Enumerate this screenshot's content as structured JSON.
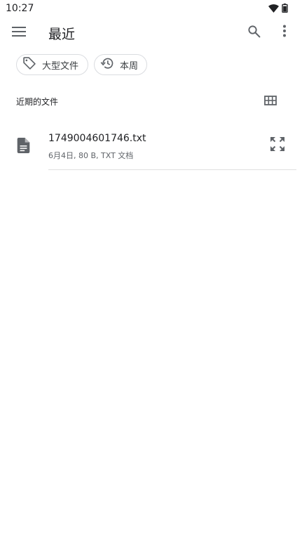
{
  "status_bar": {
    "time": "10:27",
    "icons": [
      "wifi-icon",
      "battery-icon"
    ]
  },
  "app_bar": {
    "title": "最近",
    "icons": [
      "menu-icon",
      "search-icon",
      "more-vert-icon"
    ]
  },
  "chips": [
    {
      "label": "大型文件",
      "icon": "label-tag-icon"
    },
    {
      "label": "本周",
      "icon": "history-icon"
    }
  ],
  "section": {
    "title": "近期的文件",
    "view_toggle_icon": "grid-view-icon"
  },
  "files": [
    {
      "name": "1749004601746.txt",
      "meta": "6月4日, 80 B, TXT 文档",
      "icon": "document-icon",
      "action_icon": "expand-icon"
    }
  ],
  "colors": {
    "text_primary": "#202124",
    "text_secondary": "#5f6368",
    "icon": "#5f6368",
    "chip_border": "#dadce0",
    "divider": "#e0e0e0",
    "background": "#ffffff"
  }
}
